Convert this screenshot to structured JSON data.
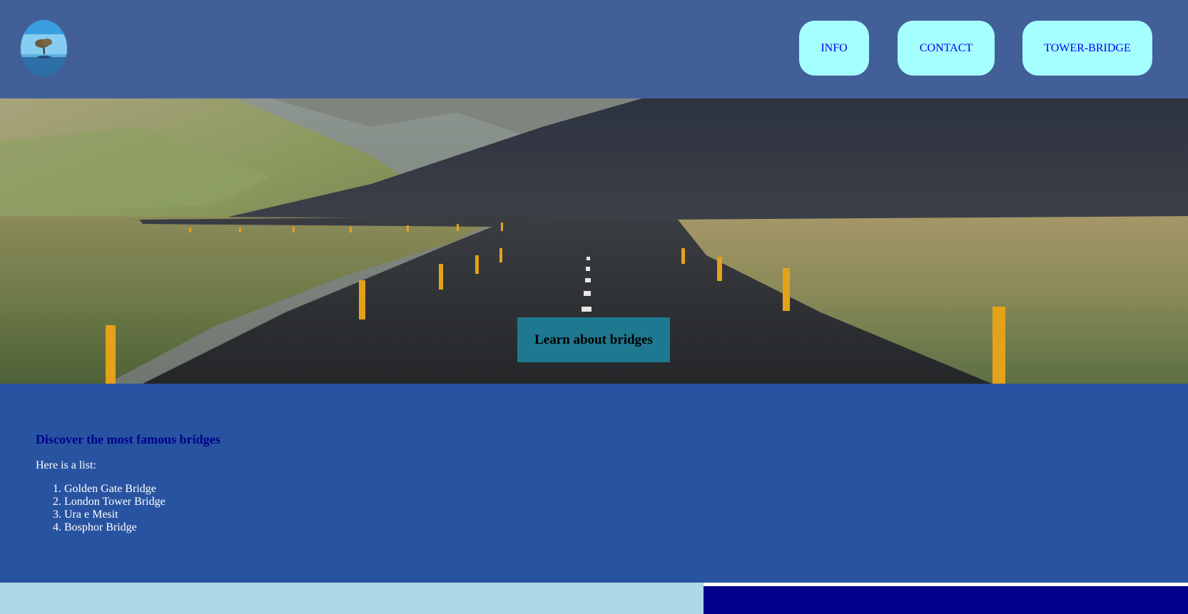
{
  "header": {
    "logo_icon": "tree-in-water-logo",
    "nav": [
      {
        "label": "INFO"
      },
      {
        "label": "CONTACT"
      },
      {
        "label": "TOWER-BRIDGE"
      }
    ],
    "background": "#425f98",
    "button_color": "#a6ffff",
    "link_color": "#0000ee"
  },
  "hero": {
    "image": "road-through-valley-photo",
    "cta_label": "Learn about bridges",
    "cta_color": "#1e7890"
  },
  "main": {
    "heading": "Discover the most famous bridges",
    "intro": "Here is a list:",
    "bridges": [
      "Golden Gate Bridge",
      "London Tower Bridge",
      "Ura e Mesit",
      "Bosphor Bridge"
    ],
    "background": "#2853a0",
    "heading_color": "#00008b"
  },
  "footer": {
    "left_color": "#add8e6",
    "right_color": "#00008b"
  }
}
